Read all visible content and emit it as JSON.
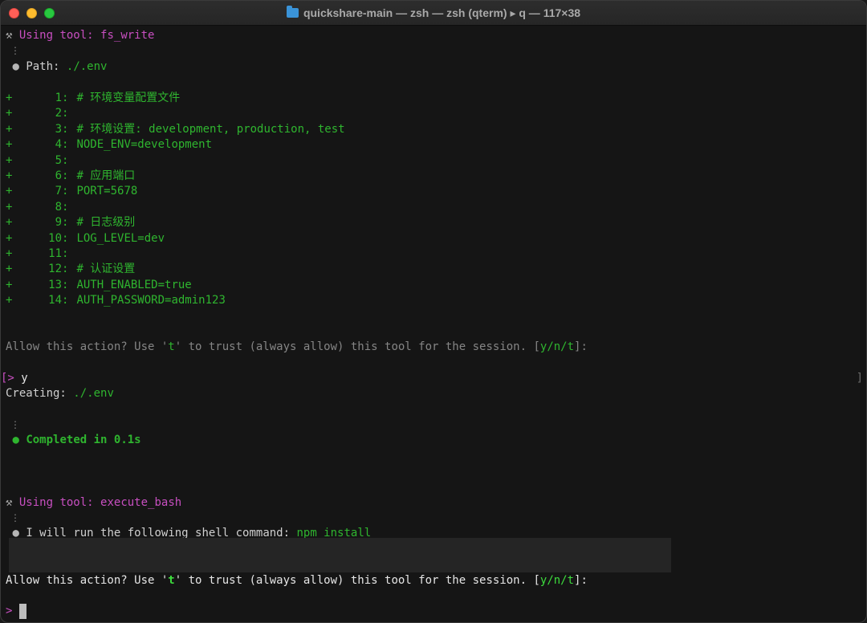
{
  "window": {
    "title": "quickshare-main — zsh — zsh (qterm) ▸ q — 117×38"
  },
  "colors": {
    "tool_magenta": "#c84fc1",
    "diff_green": "#2fb52f",
    "dim_gray": "#858585"
  },
  "tool1": {
    "prefix": "Using tool: ",
    "name": "fs_write",
    "separator": "⋮",
    "path_label": "Path: ",
    "path_value": "./.env"
  },
  "diff_lines": [
    {
      "num": "1:",
      "text": "# 环境变量配置文件"
    },
    {
      "num": "2:",
      "text": ""
    },
    {
      "num": "3:",
      "text": "# 环境设置: development, production, test"
    },
    {
      "num": "4:",
      "text": "NODE_ENV=development"
    },
    {
      "num": "5:",
      "text": ""
    },
    {
      "num": "6:",
      "text": "# 应用端口"
    },
    {
      "num": "7:",
      "text": "PORT=5678"
    },
    {
      "num": "8:",
      "text": ""
    },
    {
      "num": "9:",
      "text": "# 日志级别"
    },
    {
      "num": "10:",
      "text": "LOG_LEVEL=dev"
    },
    {
      "num": "11:",
      "text": ""
    },
    {
      "num": "12:",
      "text": "# 认证设置"
    },
    {
      "num": "13:",
      "text": "AUTH_ENABLED=true"
    },
    {
      "num": "14:",
      "text": "AUTH_PASSWORD=admin123"
    }
  ],
  "prompt1": {
    "text_a": "Allow this action? Use '",
    "key": "t",
    "text_b": "' to trust (always allow) this tool for the session. [",
    "choices": "y/n/t",
    "text_c": "]:"
  },
  "input1": {
    "prompt_symbol": "[> ",
    "value": "y",
    "right_bracket": "]"
  },
  "creating": {
    "label": "Creating: ",
    "value": "./.env"
  },
  "completed": {
    "separator": "⋮",
    "text": "Completed in 0.1s"
  },
  "tool2": {
    "prefix": "Using tool: ",
    "name": "execute_bash",
    "separator": "⋮",
    "command_label": "I will run the following shell command: ",
    "command": "npm install"
  },
  "prompt2": {
    "text_a": "Allow this action? Use '",
    "key": "t",
    "text_b": "' to trust (always allow) this tool for the session. [",
    "choices": "y/n/t",
    "text_c": "]:"
  },
  "input2": {
    "prompt_symbol": "> "
  }
}
